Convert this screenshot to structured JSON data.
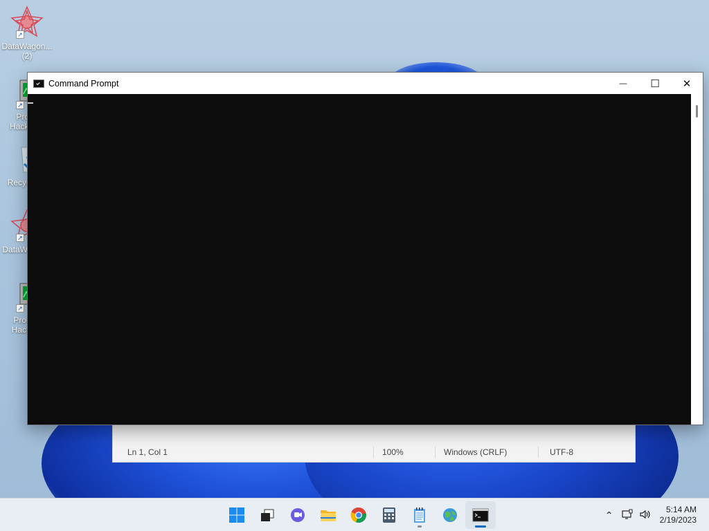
{
  "desktop": {
    "icons": [
      {
        "label": "DataWagon... (2)",
        "icon": "datawagon-icon"
      },
      {
        "label": "Proc Hacke",
        "icon": "process-hacker-icon"
      },
      {
        "label": "Recyc",
        "icon": "recycle-bin-icon"
      },
      {
        "label": "DataW",
        "icon": "datawagon-icon"
      },
      {
        "label": "Proc Hack",
        "icon": "process-hacker-icon"
      }
    ]
  },
  "cmd_window": {
    "title": "Command Prompt",
    "minimize": "—",
    "maximize": "☐",
    "close": "✕"
  },
  "notepad": {
    "status": {
      "position": "Ln 1, Col 1",
      "zoom": "100%",
      "line_endings": "Windows (CRLF)",
      "encoding": "UTF-8"
    }
  },
  "taskbar": {
    "apps": [
      {
        "name": "start",
        "icon": "windows-start-icon"
      },
      {
        "name": "task-view",
        "icon": "task-view-icon"
      },
      {
        "name": "chat",
        "icon": "teams-chat-icon"
      },
      {
        "name": "file-explorer",
        "icon": "folder-icon"
      },
      {
        "name": "chrome",
        "icon": "chrome-icon"
      },
      {
        "name": "calculator",
        "icon": "calculator-icon"
      },
      {
        "name": "notepad",
        "icon": "notepad-icon"
      },
      {
        "name": "maps",
        "icon": "globe-icon"
      },
      {
        "name": "command-prompt",
        "icon": "cmd-icon"
      }
    ],
    "tray": {
      "time": "5:14 AM",
      "date": "2/19/2023"
    }
  },
  "colors": {
    "cmd_background": "#0c0c0c",
    "taskbar_background": "#e9eef4",
    "accent": "#0067c0"
  }
}
